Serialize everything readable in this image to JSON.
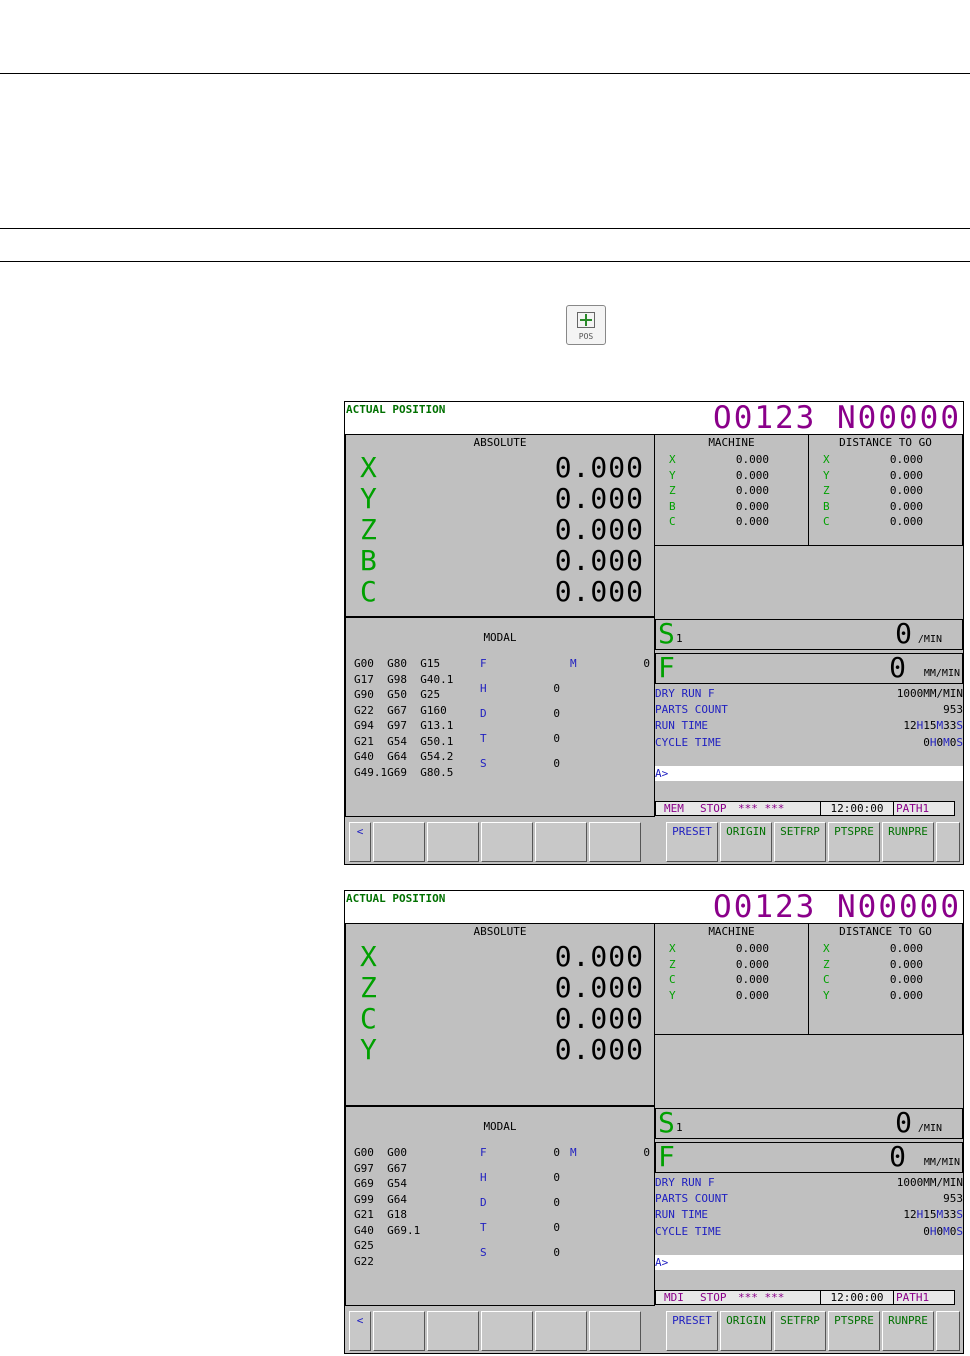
{
  "key": {
    "label": "POS"
  },
  "screens": [
    {
      "title": "ACTUAL POSITION",
      "onum": "O0123 N00000",
      "absolute": {
        "label": "ABSOLUTE",
        "axes": [
          {
            "ax": "X",
            "v": "0.000"
          },
          {
            "ax": "Y",
            "v": "0.000"
          },
          {
            "ax": "Z",
            "v": "0.000"
          },
          {
            "ax": "B",
            "v": "0.000"
          },
          {
            "ax": "C",
            "v": "0.000"
          }
        ]
      },
      "machine": {
        "label": "MACHINE",
        "axes": [
          {
            "ax": "X",
            "v": "0.000"
          },
          {
            "ax": "Y",
            "v": "0.000"
          },
          {
            "ax": "Z",
            "v": "0.000"
          },
          {
            "ax": "B",
            "v": "0.000"
          },
          {
            "ax": "C",
            "v": "0.000"
          }
        ]
      },
      "dtg": {
        "label": "DISTANCE TO GO",
        "axes": [
          {
            "ax": "X",
            "v": "0.000"
          },
          {
            "ax": "Y",
            "v": "0.000"
          },
          {
            "ax": "Z",
            "v": "0.000"
          },
          {
            "ax": "B",
            "v": "0.000"
          },
          {
            "ax": "C",
            "v": "0.000"
          }
        ]
      },
      "modal": {
        "label": "MODAL",
        "gcodes": "G00  G80  G15\nG17  G98  G40.1\nG90  G50  G25\nG22  G67  G160\nG94  G97  G13.1\nG21  G54  G50.1\nG40  G64  G54.2\nG49.1G69  G80.5",
        "F": "",
        "M": "0",
        "H": "0",
        "D": "0",
        "T": "0",
        "S": "0"
      },
      "spindle": {
        "ch": "S",
        "sub": "1",
        "val": "0",
        "unit": "/MIN"
      },
      "feed": {
        "ch": "F",
        "val": "0",
        "unit": "MM/MIN"
      },
      "info": {
        "dry_run_k": "DRY RUN F",
        "dry_run_v": "1000",
        "dry_run_u": "MM/MIN",
        "parts_k": "PARTS COUNT",
        "parts_v": "953",
        "run_k": "RUN TIME",
        "run_h": "12",
        "run_m": "15",
        "run_s": "33",
        "cycle_k": "CYCLE TIME",
        "cycle_h": "0",
        "cycle_m": "0",
        "cycle_s": "0"
      },
      "prompt": "A>",
      "status": {
        "mode": "MEM",
        "state": "STOP",
        "alarm": "*** ***",
        "time": "12:00:00",
        "path": "PATH1"
      },
      "softkeys": [
        "<",
        "PRESET",
        "ORIGIN",
        "SETFRP",
        "PTSPRE",
        "RUNPRE"
      ]
    },
    {
      "title": "ACTUAL POSITION",
      "onum": "O0123 N00000",
      "absolute": {
        "label": "ABSOLUTE",
        "axes": [
          {
            "ax": "X",
            "v": "0.000"
          },
          {
            "ax": "Z",
            "v": "0.000"
          },
          {
            "ax": "C",
            "v": "0.000"
          },
          {
            "ax": "Y",
            "v": "0.000"
          }
        ]
      },
      "machine": {
        "label": "MACHINE",
        "axes": [
          {
            "ax": "X",
            "v": "0.000"
          },
          {
            "ax": "Z",
            "v": "0.000"
          },
          {
            "ax": "C",
            "v": "0.000"
          },
          {
            "ax": "Y",
            "v": "0.000"
          }
        ]
      },
      "dtg": {
        "label": "DISTANCE TO GO",
        "axes": [
          {
            "ax": "X",
            "v": "0.000"
          },
          {
            "ax": "Z",
            "v": "0.000"
          },
          {
            "ax": "C",
            "v": "0.000"
          },
          {
            "ax": "Y",
            "v": "0.000"
          }
        ]
      },
      "modal": {
        "label": "MODAL",
        "gcodes": "G00  G00\nG97  G67\nG69  G54\nG99  G64\nG21  G18\nG40  G69.1\nG25\nG22",
        "F": "0",
        "M": "0",
        "H": "0",
        "D": "0",
        "T": "0",
        "S": "0"
      },
      "spindle": {
        "ch": "S",
        "sub": "1",
        "val": "0",
        "unit": "/MIN"
      },
      "feed": {
        "ch": "F",
        "val": "0",
        "unit": "MM/MIN"
      },
      "info": {
        "dry_run_k": "DRY RUN F",
        "dry_run_v": "1000",
        "dry_run_u": "MM/MIN",
        "parts_k": "PARTS COUNT",
        "parts_v": "953",
        "run_k": "RUN TIME",
        "run_h": "12",
        "run_m": "15",
        "run_s": "33",
        "cycle_k": "CYCLE TIME",
        "cycle_h": "0",
        "cycle_m": "0",
        "cycle_s": "0"
      },
      "prompt": "A>",
      "status": {
        "mode": "MDI",
        "state": "STOP",
        "alarm": "*** ***",
        "time": "12:00:00",
        "path": "PATH1"
      },
      "softkeys": [
        "<",
        "PRESET",
        "ORIGIN",
        "SETFRP",
        "PTSPRE",
        "RUNPRE"
      ]
    }
  ],
  "units": {
    "h": "H",
    "m": "M",
    "s": "S"
  }
}
